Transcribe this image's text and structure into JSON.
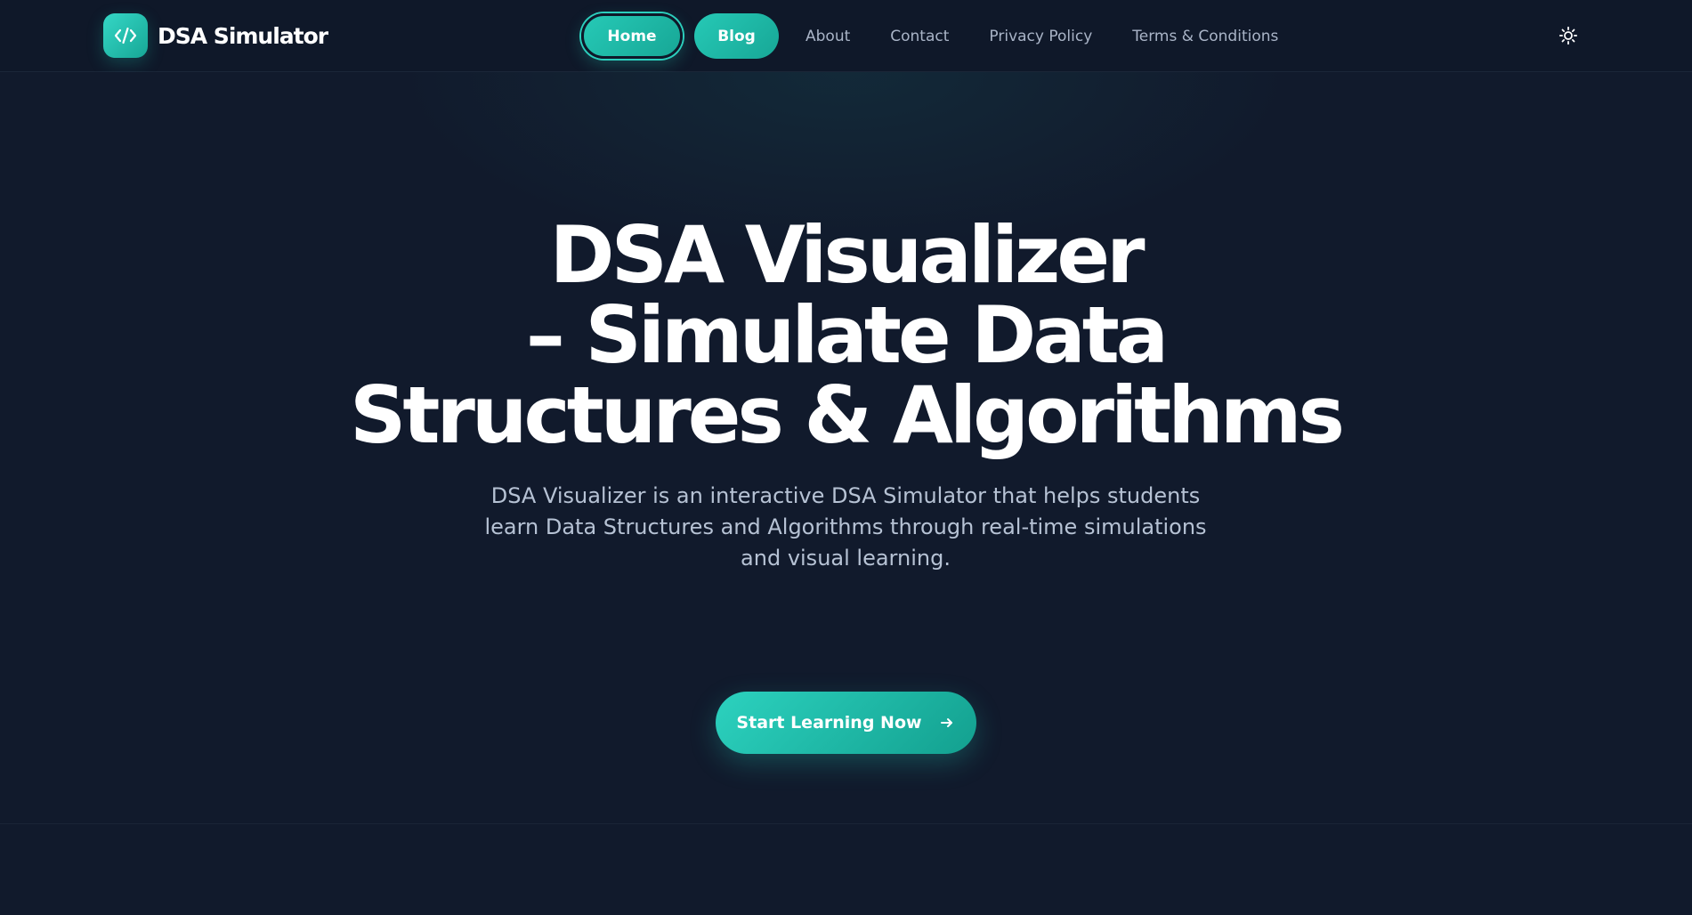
{
  "brand": {
    "name": "DSA Simulator",
    "icon": "code-icon"
  },
  "nav": {
    "items": [
      {
        "label": "Home",
        "active": true
      },
      {
        "label": "Blog",
        "active": false
      },
      {
        "label": "About",
        "active": false
      },
      {
        "label": "Contact",
        "active": false
      },
      {
        "label": "Privacy Policy",
        "active": false
      },
      {
        "label": "Terms & Conditions",
        "active": false
      }
    ],
    "theme_toggle_icon": "sun-icon"
  },
  "hero": {
    "title_lines": [
      "DSA Visualizer",
      "– Simulate Data",
      "Structures & Algorithms"
    ],
    "description": "DSA Visualizer is an interactive DSA Simulator that helps students learn Data Structures and Algorithms through real-time simulations and visual learning.",
    "cta_label": "Start Learning Now",
    "cta_icon": "arrow-right-icon"
  },
  "colors": {
    "background": "#111a2c",
    "header": "#0f1829",
    "accent": "#26c9b6",
    "text": "#ffffff",
    "muted_text": "#a9b4c7"
  }
}
